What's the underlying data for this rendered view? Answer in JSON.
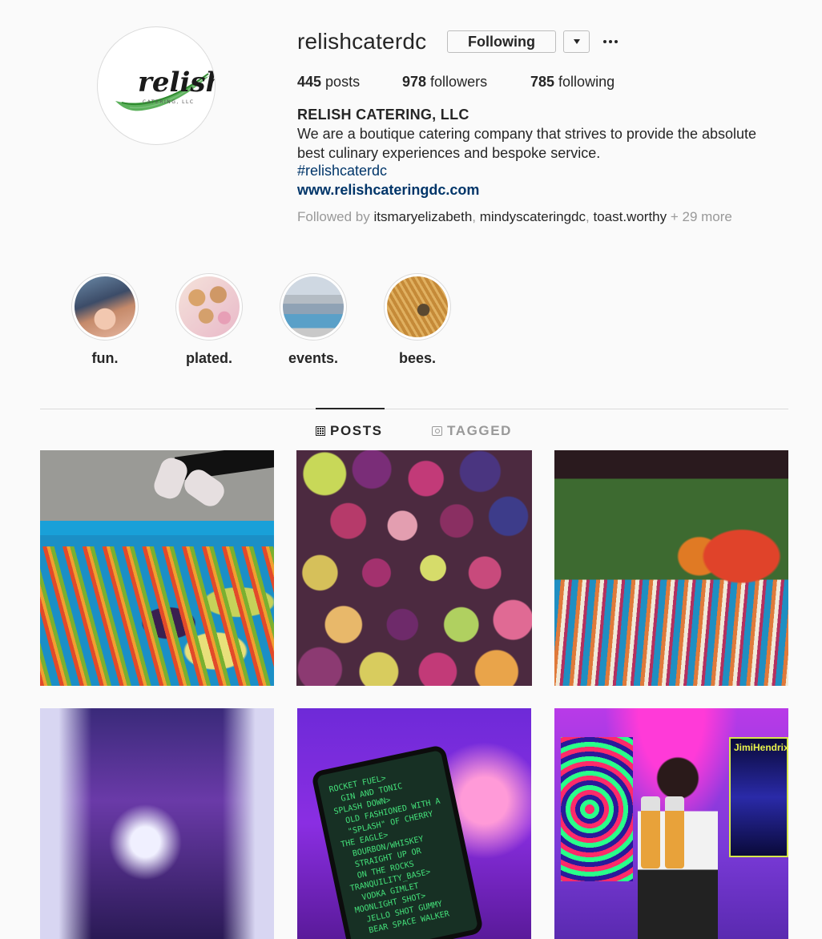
{
  "profile": {
    "username": "relishcaterdc",
    "avatar_logo_text": "relish",
    "avatar_logo_subtext": "CATERING, LLC",
    "follow_button_label": "Following",
    "dropdown_icon": "chevron-down-icon",
    "more_icon": "more-options-icon",
    "stats": {
      "posts_count": "445",
      "posts_label": "posts",
      "followers_count": "978",
      "followers_label": "followers",
      "following_count": "785",
      "following_label": "following"
    },
    "full_name": "RELISH CATERING, LLC",
    "bio": "We are a boutique catering company that strives to provide the absolute best culinary experiences and bespoke service.",
    "hashtag": "#relishcaterdc",
    "website": "www.relishcateringdc.com",
    "followed_by": {
      "prefix": "Followed by",
      "names": [
        "itsmaryelizabeth",
        "mindyscateringdc",
        "toast.worthy"
      ],
      "suffix": "+ 29 more"
    }
  },
  "highlights": [
    {
      "label": "fun."
    },
    {
      "label": "plated."
    },
    {
      "label": "events."
    },
    {
      "label": "bees."
    }
  ],
  "tabs": {
    "posts_label": "POSTS",
    "tagged_label": "TAGGED",
    "active": "POSTS"
  },
  "posts": {
    "p5_sign_text": "ROCKET FUEL>\n  GIN AND TONIC\nSPLASH DOWN>\n  OLD FASHIONED WITH A\n  \"SPLASH\" OF CHERRY\nTHE EAGLE>\n  BOURBON/WHISKEY\n  STRAIGHT UP OR\n  ON THE ROCKS\nTRANQUILITY_BASE>\n  VODKA GIMLET\nMOONLIGHT SHOT>\n  JELLO SHOT GUMMY\n  BEAR SPACE WALKER",
    "p6_poster_text": "JimiHendrix"
  },
  "colors": {
    "background": "#fafafa",
    "text": "#262626",
    "link": "#003569",
    "muted": "#999999",
    "border": "#dbdbdb",
    "logo_green": "#3a9a3a"
  }
}
